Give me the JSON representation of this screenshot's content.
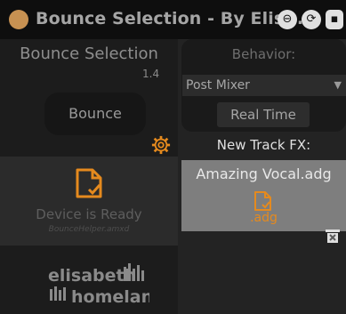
{
  "titlebar": {
    "title": "Bounce Selection - By Elis..."
  },
  "left": {
    "title": "Bounce Selection",
    "version": "1.4",
    "bounce_label": "Bounce",
    "status_text": "Device is Ready",
    "status_sub": "BounceHelper.amxd"
  },
  "right": {
    "behavior_label": "Behavior:",
    "behavior_value": "Post Mixer",
    "realtime_label": "Real Time",
    "fx_label": "New Track FX:",
    "fx_name": "Amazing Vocal.adg",
    "fx_ext": ".adg"
  },
  "logo_text": [
    "elisabeth",
    "homeland"
  ],
  "colors": {
    "accent": "#e58a1e",
    "title_dot": "#c79152"
  }
}
